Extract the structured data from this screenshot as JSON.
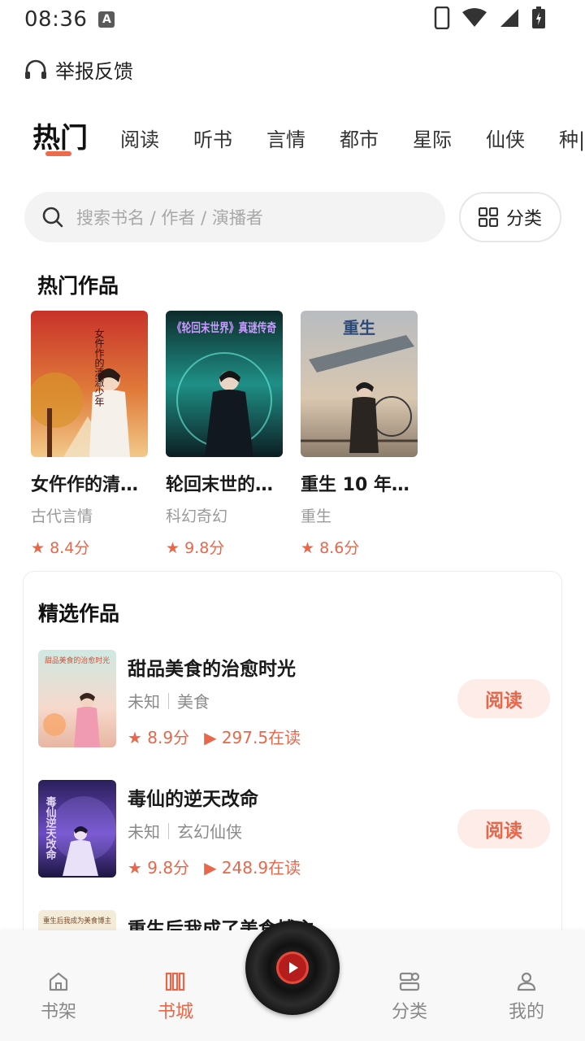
{
  "status": {
    "time": "08:36",
    "badge": "A"
  },
  "feedback": {
    "label": "举报反馈",
    "icon": "headphones-icon"
  },
  "tabs": [
    {
      "label": "热门",
      "active": true
    },
    {
      "label": "阅读"
    },
    {
      "label": "听书"
    },
    {
      "label": "言情"
    },
    {
      "label": "都市"
    },
    {
      "label": "星际"
    },
    {
      "label": "仙侠"
    },
    {
      "label": "种|"
    }
  ],
  "search": {
    "placeholder": "搜索书名 / 作者 / 演播者"
  },
  "category_button": {
    "label": "分类"
  },
  "hot": {
    "title": "热门作品",
    "items": [
      {
        "name": "女仵作的清…",
        "genre": "古代言情",
        "score": "★ 8.4分",
        "cover_text": "女仵作的清澈少年"
      },
      {
        "name": "轮回末世的…",
        "genre": "科幻奇幻",
        "score": "★ 9.8分",
        "cover_text": "《轮回末世界》真谜传奇"
      },
      {
        "name": "重生 10 年…",
        "genre": "重生",
        "score": "★ 8.6分",
        "cover_text": "重生"
      }
    ]
  },
  "featured": {
    "title": "精选作品",
    "items": [
      {
        "name": "甜品美食的治愈时光",
        "author": "未知",
        "genre": "美食",
        "score": "★ 8.9分",
        "readers": "▶ 297.5在读",
        "button": "阅读",
        "cover_text": "甜品美食的治愈时光"
      },
      {
        "name": "毒仙的逆天改命",
        "author": "未知",
        "genre": "玄幻仙侠",
        "score": "★ 9.8分",
        "readers": "▶ 248.9在读",
        "button": "阅读",
        "cover_text": "毒仙逆天改命"
      },
      {
        "name": "重生后我成了美食博主",
        "cover_text": "重生后我成为美食博主"
      }
    ]
  },
  "nav": {
    "items": [
      {
        "label": "书架"
      },
      {
        "label": "书城",
        "active": true
      },
      {
        "label": "分类"
      },
      {
        "label": "我的"
      }
    ]
  },
  "colors": {
    "accent": "#e8674a",
    "accent_bg": "#fdece7"
  }
}
